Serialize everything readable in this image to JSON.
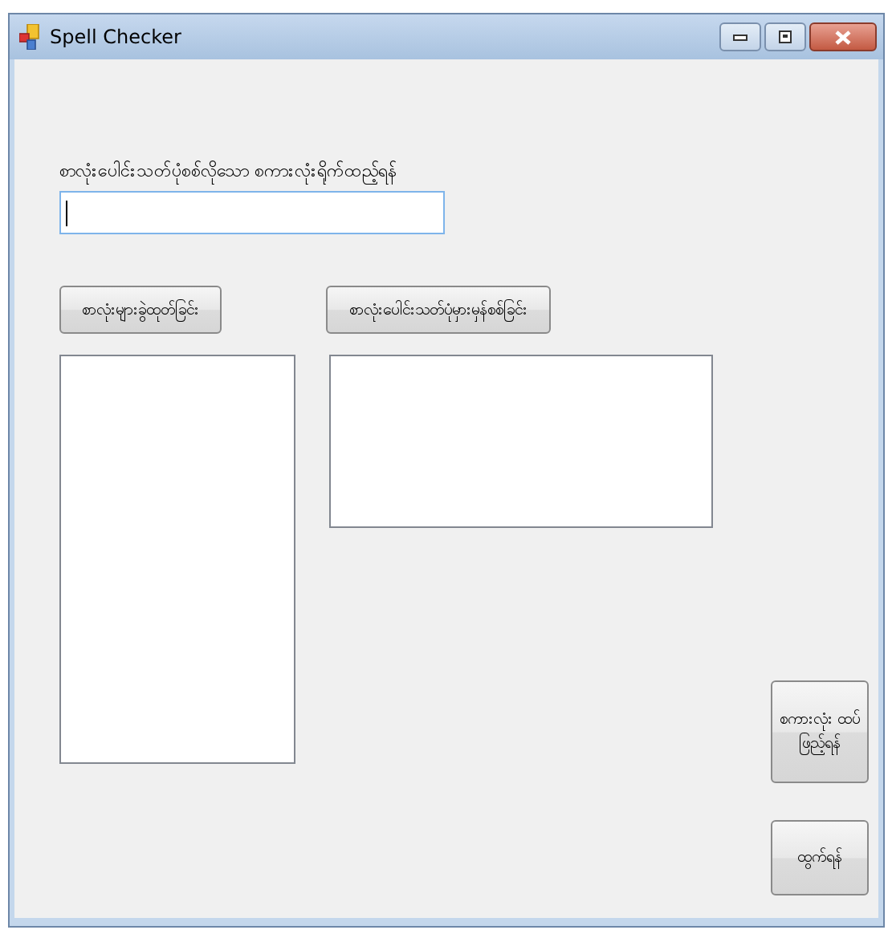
{
  "window": {
    "title": "Spell Checker"
  },
  "word_entry": {
    "label": "စာလုံးပေါင်းသတ်ပုံစစ်လိုသော စကားလုံးရိုက်ထည့်ရန်",
    "focused": true
  },
  "split_button": {
    "label": "စာလုံးများခွဲထုတ်ခြင်း"
  },
  "check_button": {
    "label": "စာလုံးပေါင်းသတ်ပုံမှားမှန်စစ်ခြင်း"
  },
  "add_button": {
    "label": "စကားလုံး ထပ်ဖြည့်ရန်"
  },
  "exit_button": {
    "label": "ထွက်ရန်"
  }
}
